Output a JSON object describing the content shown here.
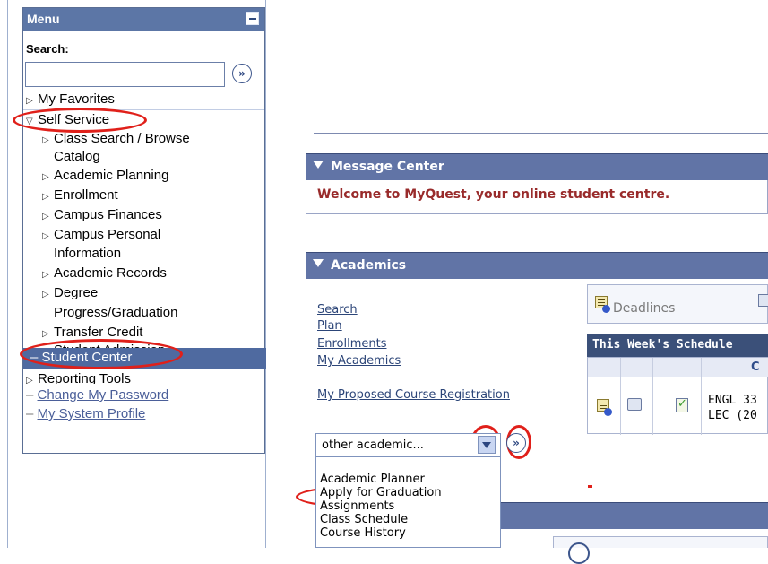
{
  "menu": {
    "title": "Menu",
    "search_label": "Search:",
    "search_value": "",
    "go_glyph": "»",
    "items": {
      "my_favorites": "My Favorites",
      "self_service": "Self Service",
      "class_search_1": "Class Search / Browse",
      "class_search_2": "Catalog",
      "academic_planning": "Academic Planning",
      "enrollment": "Enrollment",
      "campus_finances": "Campus Finances",
      "campus_personal_1": "Campus Personal",
      "campus_personal_2": "Information",
      "academic_records": "Academic Records",
      "degree_progress_1": "Degree",
      "degree_progress_2": "Progress/Graduation",
      "transfer_credit": "Transfer Credit",
      "student_admission": "Student Admission",
      "student_center": "Student Center",
      "reporting_tools": "Reporting Tools",
      "change_password": "Change My Password",
      "my_system_profile": "My System Profile"
    }
  },
  "message_center": {
    "title": "Message Center",
    "welcome": "Welcome to MyQuest, your online student centre."
  },
  "academics": {
    "title": "Academics",
    "links": [
      "Search",
      "Plan",
      "Enrollments",
      "My Academics"
    ],
    "proposed_link": "My Proposed Course Registration",
    "deadlines_label": "Deadlines",
    "week_schedule_title": "This Week's Schedule",
    "column_c": "C",
    "course_line_1": "ENGL 33",
    "course_line_2": "LEC (20",
    "select_value": "other academic...",
    "go_glyph": "»",
    "dropdown_options": [
      "Academic Planner",
      "Apply for Graduation",
      "Assignments",
      "Class Schedule",
      "Course History"
    ]
  },
  "colors": {
    "menu_header": "#5c76a6",
    "section_header": "#6174a6",
    "highlight_oval": "#e0201a",
    "selected_item": "#4f6aa0"
  },
  "icons": [
    "collapse-icon",
    "go-arrow-icon",
    "triangle-right-icon",
    "triangle-down-icon",
    "calendar-icon",
    "info-icon",
    "dropdown-arrow-icon",
    "checklist-icon",
    "meeting-icon"
  ]
}
